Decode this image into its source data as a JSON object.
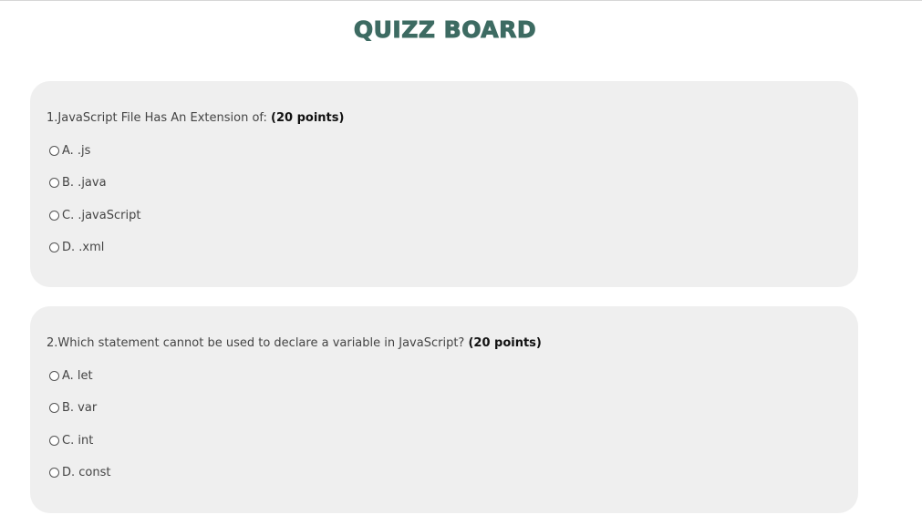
{
  "page": {
    "title": "QUIZZ BOARD"
  },
  "questions": [
    {
      "text": "1.JavaScript File Has An Extension of: ",
      "points": "(20 points)",
      "options": [
        "A. .js",
        "B. .java",
        "C. .javaScript",
        "D. .xml"
      ]
    },
    {
      "text": "2.Which statement cannot be used to declare a variable in JavaScript? ",
      "points": "(20 points)",
      "options": [
        "A. let",
        "B. var",
        "C. int",
        "D. const"
      ]
    }
  ],
  "colors": {
    "title": "#3d6b62",
    "card_background": "#efefef"
  }
}
